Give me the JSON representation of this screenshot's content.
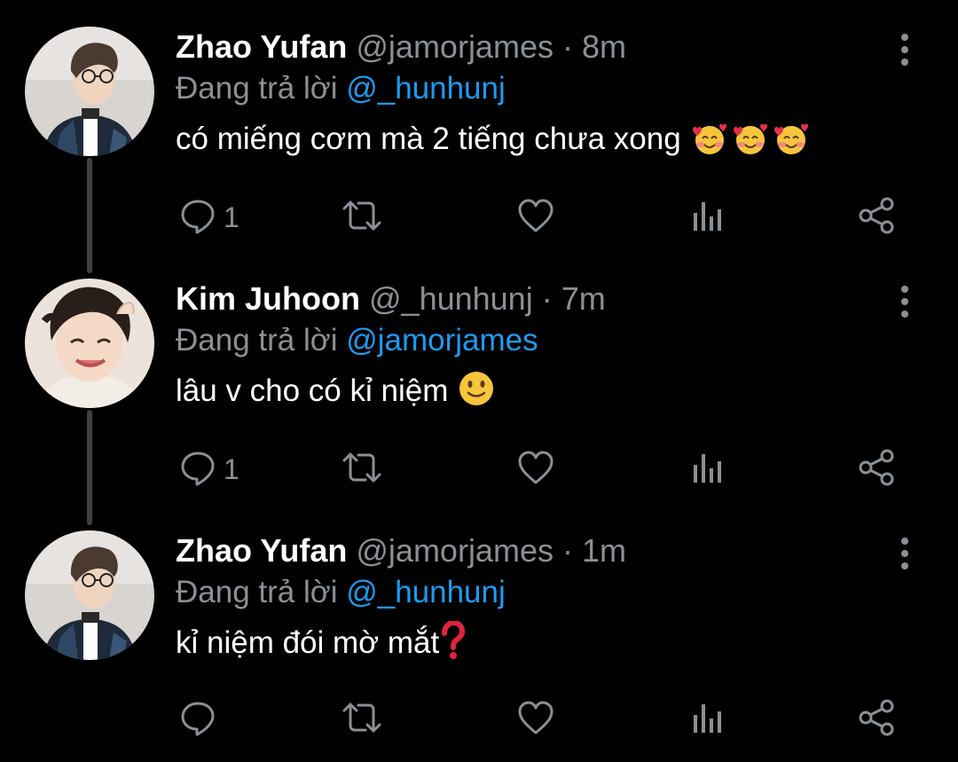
{
  "colors": {
    "background": "#000000",
    "text": "#ffffff",
    "muted": "#8b9096",
    "accent": "#1d9bf0",
    "thread_line": "#3e4144"
  },
  "tweets": [
    {
      "name": "Zhao Yufan",
      "handle": "@jamorjames",
      "separator": "·",
      "time": "8m",
      "replying_prefix": "Đang trả lời",
      "replying_to": "@_hunhunj",
      "text": "có miếng cơm mà 2 tiếng chưa xong",
      "emojis": [
        "smiling-face-with-hearts",
        "smiling-face-with-hearts",
        "smiling-face-with-hearts"
      ],
      "reply_count": "1",
      "avatar": "zhao-yufan-avatar"
    },
    {
      "name": "Kim Juhoon",
      "handle": "@_hunhunj",
      "separator": "·",
      "time": "7m",
      "replying_prefix": "Đang trả lời",
      "replying_to": "@jamorjames",
      "text": "lâu v cho có kỉ niệm",
      "emojis": [
        "slightly-smiling-face"
      ],
      "reply_count": "1",
      "avatar": "kim-juhoon-avatar"
    },
    {
      "name": "Zhao Yufan",
      "handle": "@jamorjames",
      "separator": "·",
      "time": "1m",
      "replying_prefix": "Đang trả lời",
      "replying_to": "@_hunhunj",
      "text": "kỉ niệm đói mờ mắt",
      "emojis": [
        "red-question-mark"
      ],
      "reply_count": "",
      "avatar": "zhao-yufan-avatar"
    }
  ],
  "action_icons": [
    "reply-icon",
    "retweet-icon",
    "like-icon",
    "analytics-icon",
    "share-icon"
  ]
}
